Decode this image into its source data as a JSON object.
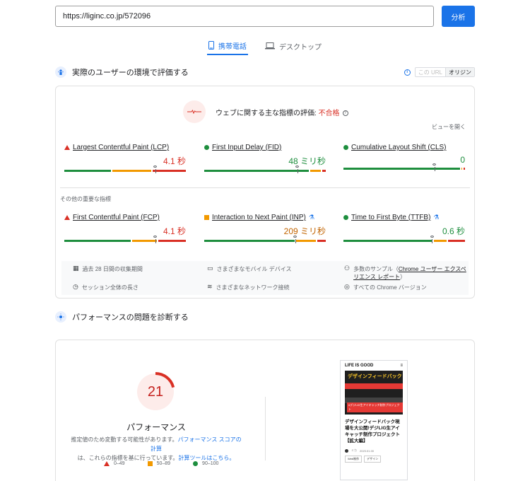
{
  "url_bar": {
    "value": "https://liginc.co.jp/572096",
    "analyze_label": "分析"
  },
  "tabs": [
    {
      "label": "携帯電話",
      "active": true
    },
    {
      "label": "デスクトップ",
      "active": false
    }
  ],
  "field_section": {
    "title": "実際のユーザーの環境で評価する",
    "toggle": {
      "this_url": "この URL",
      "origin": "オリジン"
    },
    "assessment": {
      "label": "ウェブに関する主な指標の評価: ",
      "result": "不合格"
    },
    "expand": "ビューを開く",
    "core_metrics": [
      {
        "name": "Largest Contentful Paint (LCP)",
        "value": "4.1 秒",
        "status": "poor",
        "distribution": [
          0.39,
          0.33,
          0.28
        ],
        "marker": 0.75
      },
      {
        "name": "First Input Delay (FID)",
        "value": "48 ミリ秒",
        "status": "good",
        "distribution": [
          0.88,
          0.09,
          0.03
        ],
        "marker": 0.77
      },
      {
        "name": "Cumulative Layout Shift (CLS)",
        "value": "0",
        "status": "good",
        "distribution": [
          0.98,
          0.01,
          0.01
        ],
        "marker": 0.75
      }
    ],
    "other_label": "その他の重要な指標",
    "other_metrics": [
      {
        "name": "First Contentful Paint (FCP)",
        "value": "4.1 秒",
        "status": "poor",
        "experimental": false,
        "distribution": [
          0.56,
          0.21,
          0.23
        ],
        "marker": 0.75
      },
      {
        "name": "Interaction to Next Paint (INP)",
        "value": "209 ミリ秒",
        "status": "needs-improvement",
        "experimental": true,
        "distribution": [
          0.76,
          0.17,
          0.07
        ],
        "marker": 0.75
      },
      {
        "name": "Time to First Byte (TTFB)",
        "value": "0.6 秒",
        "status": "good",
        "experimental": true,
        "distribution": [
          0.75,
          0.11,
          0.14
        ],
        "marker": 0.73
      }
    ],
    "info": {
      "period": "過去 28 日間の収集期間",
      "devices": "さまざまなモバイル デバイス",
      "samples_prefix": "多数のサンプル（",
      "samples_link": "Chrome ユーザー エクスペリエンス レポート",
      "samples_suffix": "）",
      "duration": "セッション全体の長さ",
      "network": "さまざまなネットワーク接続",
      "versions": "すべての Chrome バージョン"
    }
  },
  "lab_section": {
    "title": "パフォーマンスの問題を診断する",
    "score": "21",
    "score_fraction": 0.21,
    "score_label": "パフォーマンス",
    "desc_1": "推定値のため変動する可能性があります。",
    "desc_link_1": "パフォーマンス スコアの計算",
    "desc_2": "は、これらの指標を基に行っています。",
    "desc_link_2": "計算ツールはこちら。",
    "legend": [
      {
        "range": "0–49",
        "shape": "triangle",
        "color": "#d93025"
      },
      {
        "range": "50–89",
        "shape": "square",
        "color": "#f29900"
      },
      {
        "range": "90–100",
        "shape": "circle",
        "color": "#1e8e3e"
      }
    ],
    "screenshot": {
      "logo": "LIFE IS GOOD",
      "menu": "≡",
      "hero_text": "デザインフィードバック",
      "hero_sub": "#デジLIG生アイキャッチ制作プロジェクト",
      "title": "デザインフィードバック現場を大公開!デジLIG生アイキャッチ制作プロジェクト【拡大編】",
      "author": "ミカ",
      "date": "2023.01.00",
      "tags": [
        "Web制作",
        "デザイン"
      ]
    }
  },
  "colors": {
    "accent": "#1a73e8",
    "poor": "#d93025",
    "average": "#f29900",
    "good": "#1e8e3e"
  }
}
